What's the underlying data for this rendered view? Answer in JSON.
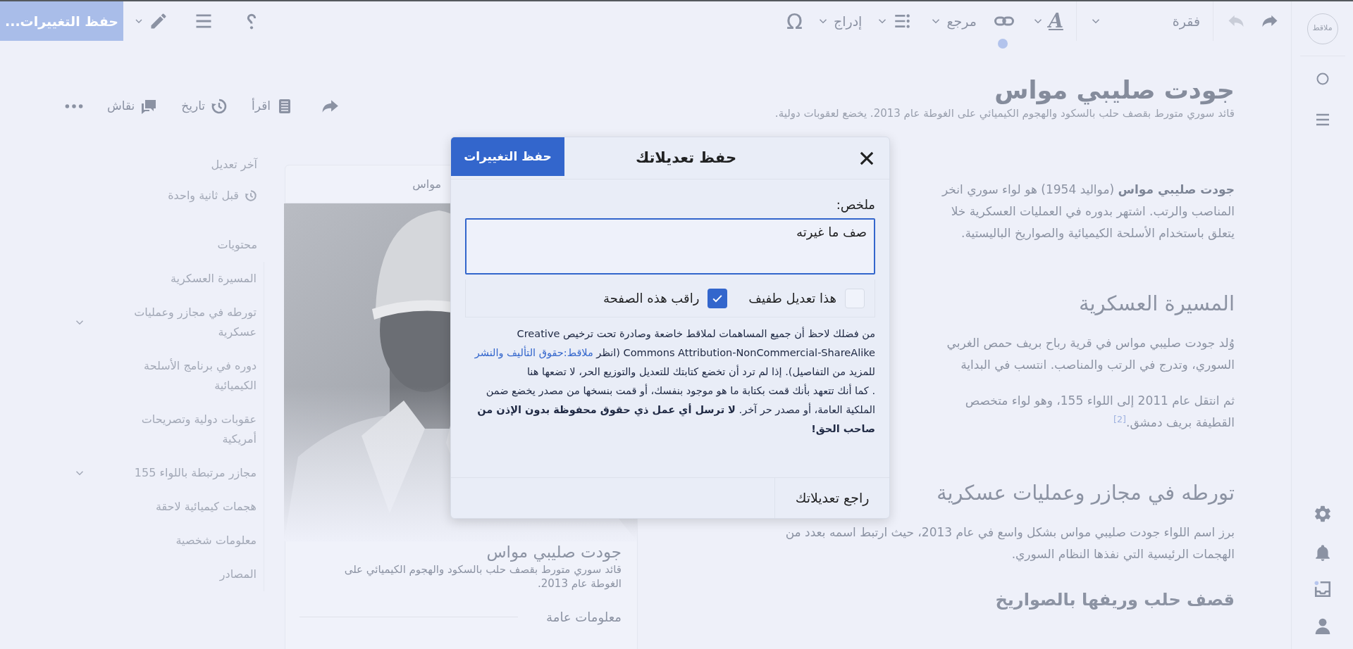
{
  "toolbar": {
    "save_button": "حفظ التغييرات...",
    "paragraph_format": "فقرة",
    "text_style": "A",
    "reference": "مرجع",
    "insert": "إدراج",
    "special_characters": "Ω",
    "undo_disabled": true,
    "link_indicator": true
  },
  "rail": {
    "logo": "ملاقط"
  },
  "page": {
    "title": "جودت صليبي مواس",
    "subtitle": "قائد سوري متورط بقصف حلب بالسكود والهجوم الكيميائي على الغوطة عام 2013. يخضع لعقوبات دولية.",
    "actions": [
      {
        "kind": "read",
        "label": "اقرأ"
      },
      {
        "kind": "history",
        "label": "تاريخ"
      },
      {
        "kind": "talk",
        "label": "نقاش"
      }
    ]
  },
  "sidebar": {
    "last_edit_label": "آخر تعديل",
    "last_edit_time": "قبل ثانية واحدة",
    "contents_heading": "محتويات",
    "toc": [
      {
        "label": "المسيرة العسكرية",
        "expandable": false
      },
      {
        "label": "تورطه في مجازر وعمليات عسكرية",
        "expandable": true
      },
      {
        "label": "دوره في برنامج الأسلحة الكيميائية",
        "expandable": false
      },
      {
        "label": "عقوبات دولية وتصريحات أمريكية",
        "expandable": false
      },
      {
        "label": "مجازر مرتبطة باللواء 155",
        "expandable": true
      },
      {
        "label": "هجمات كيميائية لاحقة",
        "expandable": false
      },
      {
        "label": "معلومات شخصية",
        "expandable": false
      },
      {
        "label": "المصادر",
        "expandable": false
      }
    ]
  },
  "infobox": {
    "caption": "مواس",
    "name": "جودت صليبي مواس",
    "description": "قائد سوري متورط بقصف حلب بالسكود والهجوم الكيميائي على الغوطة عام 2013.",
    "section": "معلومات عامة"
  },
  "article": {
    "blocks": [
      {
        "kind": "paragraph",
        "lines": [
          "**جودت صليبي مواس** (مواليد 1954) هو لواء سوري انخر",
          "المناصب والرتب. اشتهر بدوره في العمليات العسكرية خلا",
          "يتعلق باستخدام الأسلحة الكيميائية والصواريخ الباليستية."
        ]
      },
      {
        "kind": "heading",
        "text": "المسيرة العسكرية"
      },
      {
        "kind": "paragraph",
        "lines": [
          "وُلد جودت صليبي مواس في قرية رباح بريف حمص الغربي",
          "السوري، وتدرج في الرتب والمناصب. انتسب في البداية"
        ]
      },
      {
        "kind": "paragraph",
        "lines": [
          "ثم انتقل عام 2011 إلى اللواء 155، وهو لواء متخصص",
          "القطيفة بريف دمشق.$^{[2]}$"
        ]
      },
      {
        "kind": "heading",
        "text": "تورطه في مجازر وعمليات عسكرية"
      },
      {
        "kind": "paragraph",
        "lines": [
          "برز اسم اللواء جودت صليبي مواس بشكل واسع في عام 2013، حيث ارتبط اسمه بعدد من",
          "الهجمات الرئيسية التي نفذها النظام السوري."
        ]
      },
      {
        "kind": "subheading",
        "text": "قصف حلب وريفها بالصواريخ"
      }
    ]
  },
  "dialog": {
    "title": "حفظ تعديلاتك",
    "save_button": "حفظ التغييرات",
    "summary_label": "ملخص:",
    "summary_value": "صف ما غيرته",
    "checkboxes": [
      {
        "label": "هذا تعديل طفيف",
        "checked": false
      },
      {
        "label": "راقب هذه الصفحة",
        "checked": true
      }
    ],
    "notice": [
      {
        "text_before": "من فضلك لاحظ أن جميع المساهمات لملاقط خاضعة وصادرة تحت ترخيص Creative Commons Attribution-NonCommercial-ShareAlike (انظر ",
        "link": "ملاقط:حقوق التأليف والنشر",
        "text_after": " للمزيد من التفاصيل). إذا لم ترد أن تخضع كتابتك للتعديل والتوزيع الحر، لا تضعها هنا"
      },
      {
        "text_before": ". كما أنك تتعهد بأنك قمت بكتابة ما هو موجود بنفسك، أو قمت بنسخها من مصدر يخضع ضمن الملكية العامة، أو مصدر حر آخر. **لا ترسل أي عمل ذي حقوق محفوظة بدون الإذن من صاحب الحق!**"
      }
    ],
    "review_button": "راجع تعديلاتك"
  }
}
